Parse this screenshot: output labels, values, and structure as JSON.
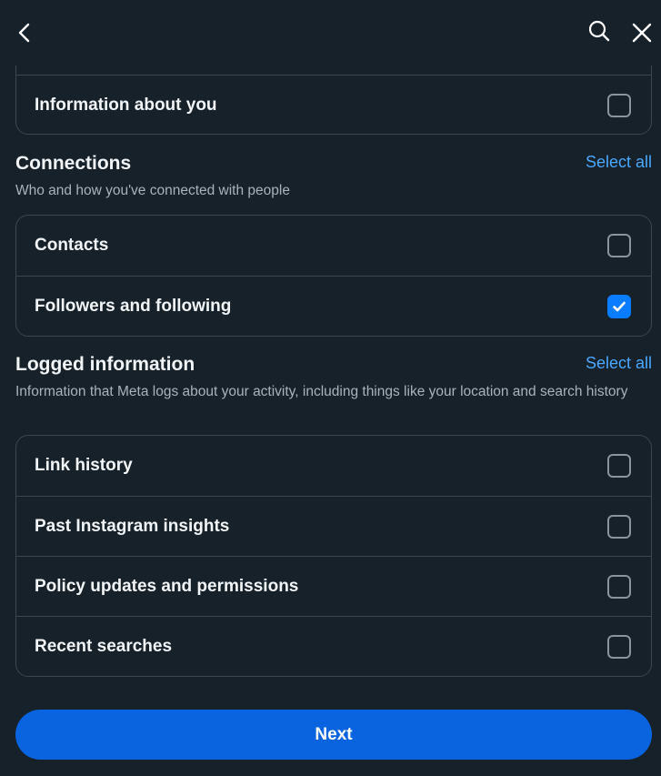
{
  "header": {
    "back_icon": "chevron-left-icon",
    "search_icon": "search-icon",
    "close_icon": "close-icon"
  },
  "top_card": {
    "items": [
      {
        "label": "Information about you",
        "checked": false
      }
    ]
  },
  "connections": {
    "title": "Connections",
    "select_all": "Select all",
    "description": "Who and how you've connected with people",
    "items": [
      {
        "label": "Contacts",
        "checked": false
      },
      {
        "label": "Followers and following",
        "checked": true
      }
    ]
  },
  "logged": {
    "title": "Logged information",
    "select_all": "Select all",
    "description": "Information that Meta logs about your activity, including things like your location and search history",
    "items": [
      {
        "label": "Link history",
        "checked": false
      },
      {
        "label": "Past Instagram insights",
        "checked": false
      },
      {
        "label": "Policy updates and permissions",
        "checked": false
      },
      {
        "label": "Recent searches",
        "checked": false
      }
    ]
  },
  "footer": {
    "next_label": "Next"
  },
  "colors": {
    "background": "#16212a",
    "accent": "#0a7cff",
    "link": "#4aa8ff",
    "button": "#0a64e0"
  }
}
